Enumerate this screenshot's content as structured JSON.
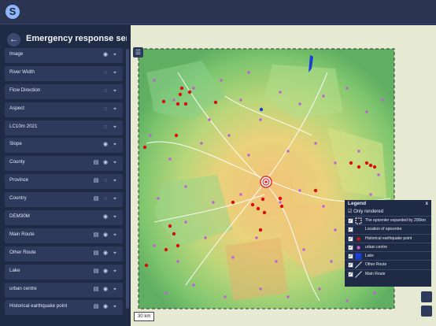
{
  "app": {
    "logo_glyph": "S",
    "title": "Emergency response ser..."
  },
  "sidebar": {
    "back_glyph": "←",
    "layers": [
      {
        "label": "Image",
        "icons": [
          "eye-icon",
          "pin-icon"
        ]
      },
      {
        "label": "River Width",
        "icons": [
          "eye-off-icon",
          "pin-icon"
        ]
      },
      {
        "label": "Flow Direction",
        "icons": [
          "eye-off-icon",
          "pin-icon"
        ]
      },
      {
        "label": "Aspect",
        "icons": [
          "eye-off-icon",
          "pin-icon"
        ]
      },
      {
        "label": "LC10m 2021",
        "icons": [
          "eye-off-icon",
          "pin-icon"
        ]
      },
      {
        "label": "Slope",
        "icons": [
          "eye-icon",
          "pin-icon"
        ]
      },
      {
        "label": "County",
        "icons": [
          "table-icon",
          "eye-icon",
          "pin-icon"
        ]
      },
      {
        "label": "Province",
        "icons": [
          "table-icon",
          "eye-off-icon",
          "pin-icon"
        ]
      },
      {
        "label": "Country",
        "icons": [
          "table-icon",
          "eye-off-icon",
          "pin-icon"
        ]
      },
      {
        "label": "DEM30M",
        "icons": [
          "eye-icon",
          "pin-icon"
        ]
      },
      {
        "label": "Main Route",
        "icons": [
          "table-icon",
          "eye-icon",
          "pin-icon"
        ]
      },
      {
        "label": "Other Route",
        "icons": [
          "table-icon",
          "eye-icon",
          "pin-icon"
        ]
      },
      {
        "label": "Lake",
        "icons": [
          "table-icon",
          "eye-icon",
          "pin-icon"
        ]
      },
      {
        "label": "urban centre",
        "icons": [
          "table-icon",
          "eye-icon",
          "pin-icon"
        ]
      },
      {
        "label": "Historical earthquake point",
        "icons": [
          "table-icon",
          "eye-icon",
          "pin-icon"
        ]
      }
    ]
  },
  "map": {
    "scale_label": "30 km",
    "menu_glyph": "☰"
  },
  "legend": {
    "title": "Legend",
    "close_glyph": "x",
    "only_rendered_label": "Only rendered",
    "items": [
      {
        "label": "The epicenter expanded by 200km",
        "symbol": "dashed-box"
      },
      {
        "label": "Location of epicentre",
        "symbol": "blank"
      },
      {
        "label": "Historical earthquake point",
        "symbol": "red-dot"
      },
      {
        "label": "urban centre",
        "symbol": "purple-dot"
      },
      {
        "label": "Lake",
        "symbol": "blue-fill"
      },
      {
        "label": "Other Route",
        "symbol": "line"
      },
      {
        "label": "Main Route",
        "symbol": "line"
      }
    ]
  },
  "colors": {
    "epicenter_red": "#e0322d",
    "earthquake_red": "#d90f0f",
    "urban_purple": "#c060d8",
    "lake_blue": "#1a3fd8",
    "sidebar_bg": "#1f2a44",
    "panel_item_bg": "#2e3a5c"
  }
}
